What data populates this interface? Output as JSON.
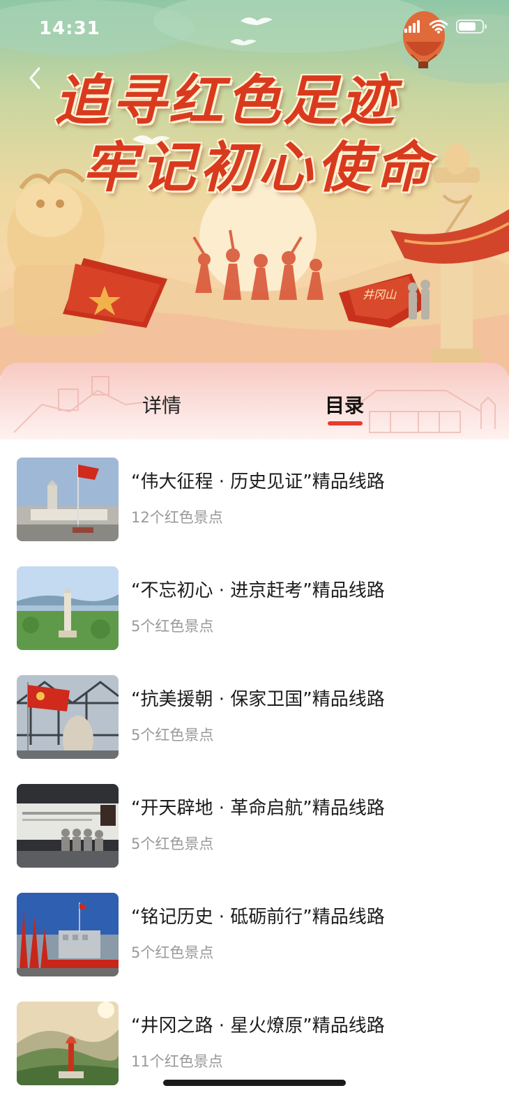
{
  "status_bar": {
    "time": "14:31"
  },
  "hero": {
    "title_line_1": "追寻红色足迹",
    "title_line_2": "牢记初心使命",
    "sign_text": "井冈山"
  },
  "tabs": [
    {
      "label": "详情",
      "active": false
    },
    {
      "label": "目录",
      "active": true
    }
  ],
  "accent_color": "#e63b2e",
  "routes": [
    {
      "title": "“伟大征程 · 历史见证”精品线路",
      "count": "12个红色景点"
    },
    {
      "title": "“不忘初心 · 进京赶考”精品线路",
      "count": "5个红色景点"
    },
    {
      "title": "“抗美援朝 · 保家卫国”精品线路",
      "count": "5个红色景点"
    },
    {
      "title": "“开天辟地 · 革命启航”精品线路",
      "count": "5个红色景点"
    },
    {
      "title": "“铭记历史 · 砥砺前行”精品线路",
      "count": "5个红色景点"
    },
    {
      "title": "“井冈之路 · 星火燎原”精品线路",
      "count": "11个红色景点"
    }
  ],
  "icons": {
    "back": "chevron-left-icon",
    "signal": "signal-icon",
    "wifi": "wifi-icon",
    "battery": "battery-icon"
  }
}
